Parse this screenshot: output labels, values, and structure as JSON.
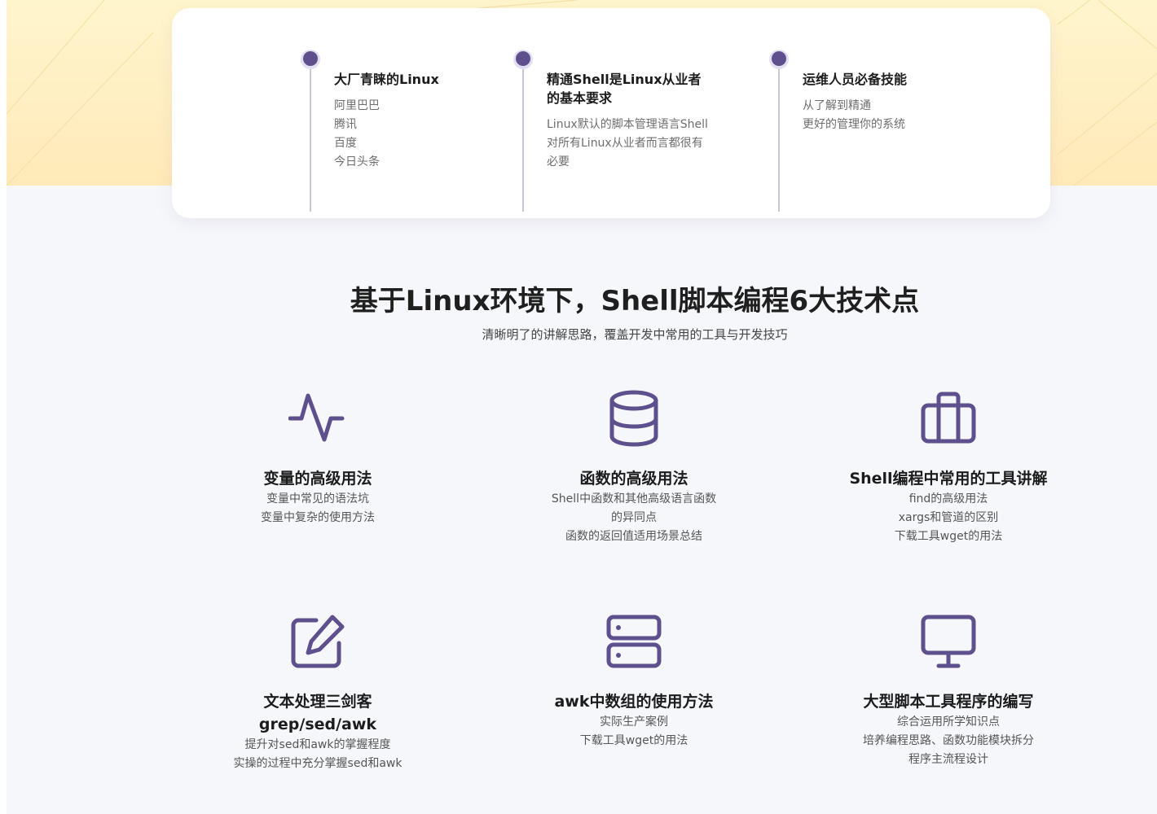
{
  "timeline": [
    {
      "title": "大厂青睐的Linux",
      "lines": [
        "阿里巴巴",
        "腾讯",
        "百度",
        "今日头条"
      ]
    },
    {
      "title": "精通Shell是Linux从业者的基本要求",
      "lines": [
        "Linux默认的脚本管理语言Shell",
        "对所有Linux从业者而言都很有",
        "必要"
      ]
    },
    {
      "title": "运维人员必备技能",
      "lines": [
        "从了解到精通",
        "更好的管理你的系统"
      ]
    }
  ],
  "section": {
    "title": "基于Linux环境下，Shell脚本编程6大技术点",
    "subtitle": "清晰明了的讲解思路，覆盖开发中常用的工具与开发技巧"
  },
  "features": [
    {
      "icon": "activity-icon",
      "title": "变量的高级用法",
      "lines": [
        "变量中常见的语法坑",
        "变量中复杂的使用方法"
      ]
    },
    {
      "icon": "database-icon",
      "title": "函数的高级用法",
      "lines": [
        "Shell中函数和其他高级语言函数",
        "的异同点",
        "函数的返回值适用场景总结"
      ]
    },
    {
      "icon": "toolbox-icon",
      "title": "Shell编程中常用的工具讲解",
      "lines": [
        "find的高级用法",
        "xargs和管道的区别",
        "下载工具wget的用法"
      ]
    },
    {
      "icon": "edit-icon",
      "title": "文本处理三剑客grep/sed/awk",
      "lines": [
        "提升对sed和awk的掌握程度",
        "实操的过程中充分掌握sed和awk"
      ]
    },
    {
      "icon": "server-icon",
      "title": "awk中数组的使用方法",
      "lines": [
        "实际生产案例",
        "下载工具wget的用法"
      ]
    },
    {
      "icon": "monitor-icon",
      "title": "大型脚本工具程序的编写",
      "lines": [
        "综合运用所学知识点",
        "培养编程思路、函数功能模块拆分",
        "程序主流程设计"
      ]
    }
  ],
  "colors": {
    "accent": "#5e4f8d",
    "hero": "#ffeec2"
  }
}
